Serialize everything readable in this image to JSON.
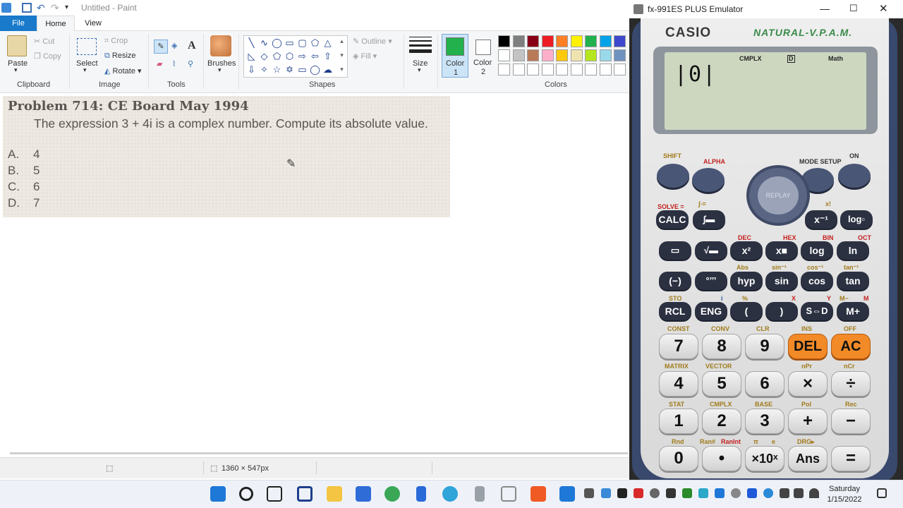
{
  "paint": {
    "title": "Untitled - Paint",
    "tabs": {
      "file": "File",
      "home": "Home",
      "view": "View"
    },
    "clipboard": {
      "paste": "Paste",
      "cut": "Cut",
      "copy": "Copy",
      "group": "Clipboard"
    },
    "image": {
      "select": "Select",
      "crop": "Crop",
      "resize": "Resize",
      "rotate": "Rotate",
      "group": "Image"
    },
    "tools": {
      "group": "Tools"
    },
    "brushes": {
      "label": "Brushes"
    },
    "shapes": {
      "outline": "Outline",
      "fill": "Fill",
      "group": "Shapes"
    },
    "size": {
      "label": "Size"
    },
    "colors": {
      "color1_line1": "Color",
      "color1_line2": "1",
      "color2_line1": "Color",
      "color2_line2": "2",
      "group": "Colors",
      "color1_value": "#22b14c",
      "palette_row1": [
        "#000000",
        "#7f7f7f",
        "#880015",
        "#ed1c24",
        "#ff7f27",
        "#fff200",
        "#22b14c",
        "#00a2e8",
        "#3f48cc"
      ],
      "palette_row2": [
        "#ffffff",
        "#c3c3c3",
        "#b97a57",
        "#ffaec9",
        "#ffc90e",
        "#efe4b0",
        "#b5e61d",
        "#99d9ea",
        "#7092be"
      ]
    },
    "problem": {
      "title": "Problem 714: CE Board May 1994",
      "text": "The expression 3 + 4i is a complex number. Compute its absolute value.",
      "options": [
        {
          "letter": "A.",
          "value": "4"
        },
        {
          "letter": "B.",
          "value": "5"
        },
        {
          "letter": "C.",
          "value": "6"
        },
        {
          "letter": "D.",
          "value": "7"
        }
      ]
    },
    "status": {
      "canvas_size": "1360 × 547px"
    }
  },
  "emulator": {
    "title": "fx-991ES PLUS Emulator",
    "brand": "CASIO",
    "model": "NATURAL-V.P.A.M.",
    "display": {
      "indicator_cmplx": "CMPLX",
      "indicator_d": "D",
      "indicator_math": "Math",
      "input": "|0|"
    },
    "top": {
      "shift": "SHIFT",
      "alpha": "ALPHA",
      "mode_setup": "MODE SETUP",
      "on": "ON",
      "replay": "REPLAY"
    },
    "row1": {
      "solve": "SOLVE =",
      "calc": "CALC",
      "xinv_label": "x!",
      "xinv": "x⁻¹",
      "log": "log▫",
      "integral": "∫▫="
    },
    "row2": {
      "dec": "DEC",
      "hex": "HEX",
      "bin": "BIN",
      "oct": "OCT",
      "x2": "x²",
      "xpow": "x■",
      "log_key": "log",
      "ln_key": "ln"
    },
    "row3": {
      "neg": "(−)",
      "deg": "°’’’",
      "hyp": "hyp",
      "sin": "sin",
      "cos": "cos",
      "tan": "tan",
      "abs": "Abs",
      "sin_inv": "sin⁻¹",
      "cos_inv": "cos⁻¹",
      "tan_inv": "tan⁻¹"
    },
    "row4": {
      "sto": "STO",
      "rcl": "RCL",
      "eng": "ENG",
      "lpar": "(",
      "rpar": ")",
      "sd": "S⇔D",
      "mplus": "M+",
      "mminus": "M−",
      "m": "M",
      "percent": "%",
      "x": "X",
      "y": "Y",
      "i": "i"
    },
    "row5": {
      "const": "CONST",
      "conv": "CONV",
      "clr": "CLR",
      "ins": "INS",
      "off": "OFF",
      "k7": "7",
      "k8": "8",
      "k9": "9",
      "del": "DEL",
      "ac": "AC"
    },
    "row6": {
      "matrix": "MATRIX",
      "vector": "VECTOR",
      "npr": "nPr",
      "ncr": "nCr",
      "k4": "4",
      "k5": "5",
      "k6": "6",
      "mul": "×",
      "div": "÷"
    },
    "row7": {
      "stat": "STAT",
      "cmplx": "CMPLX",
      "base": "BASE",
      "pol": "Pol",
      "rec": "Rec",
      "k1": "1",
      "k2": "2",
      "k3": "3",
      "plus": "+",
      "minus": "−"
    },
    "row8": {
      "rnd": "Rnd",
      "ran": "Ran#",
      "ranint": "RanInt",
      "pi": "π",
      "e": "e",
      "drg": "DRG▸",
      "k0": "0",
      "dot": "•",
      "x10": "×10ˣ",
      "ans": "Ans",
      "eq": "="
    }
  },
  "taskbar": {
    "day": "Saturday",
    "date": "1/15/2022"
  }
}
